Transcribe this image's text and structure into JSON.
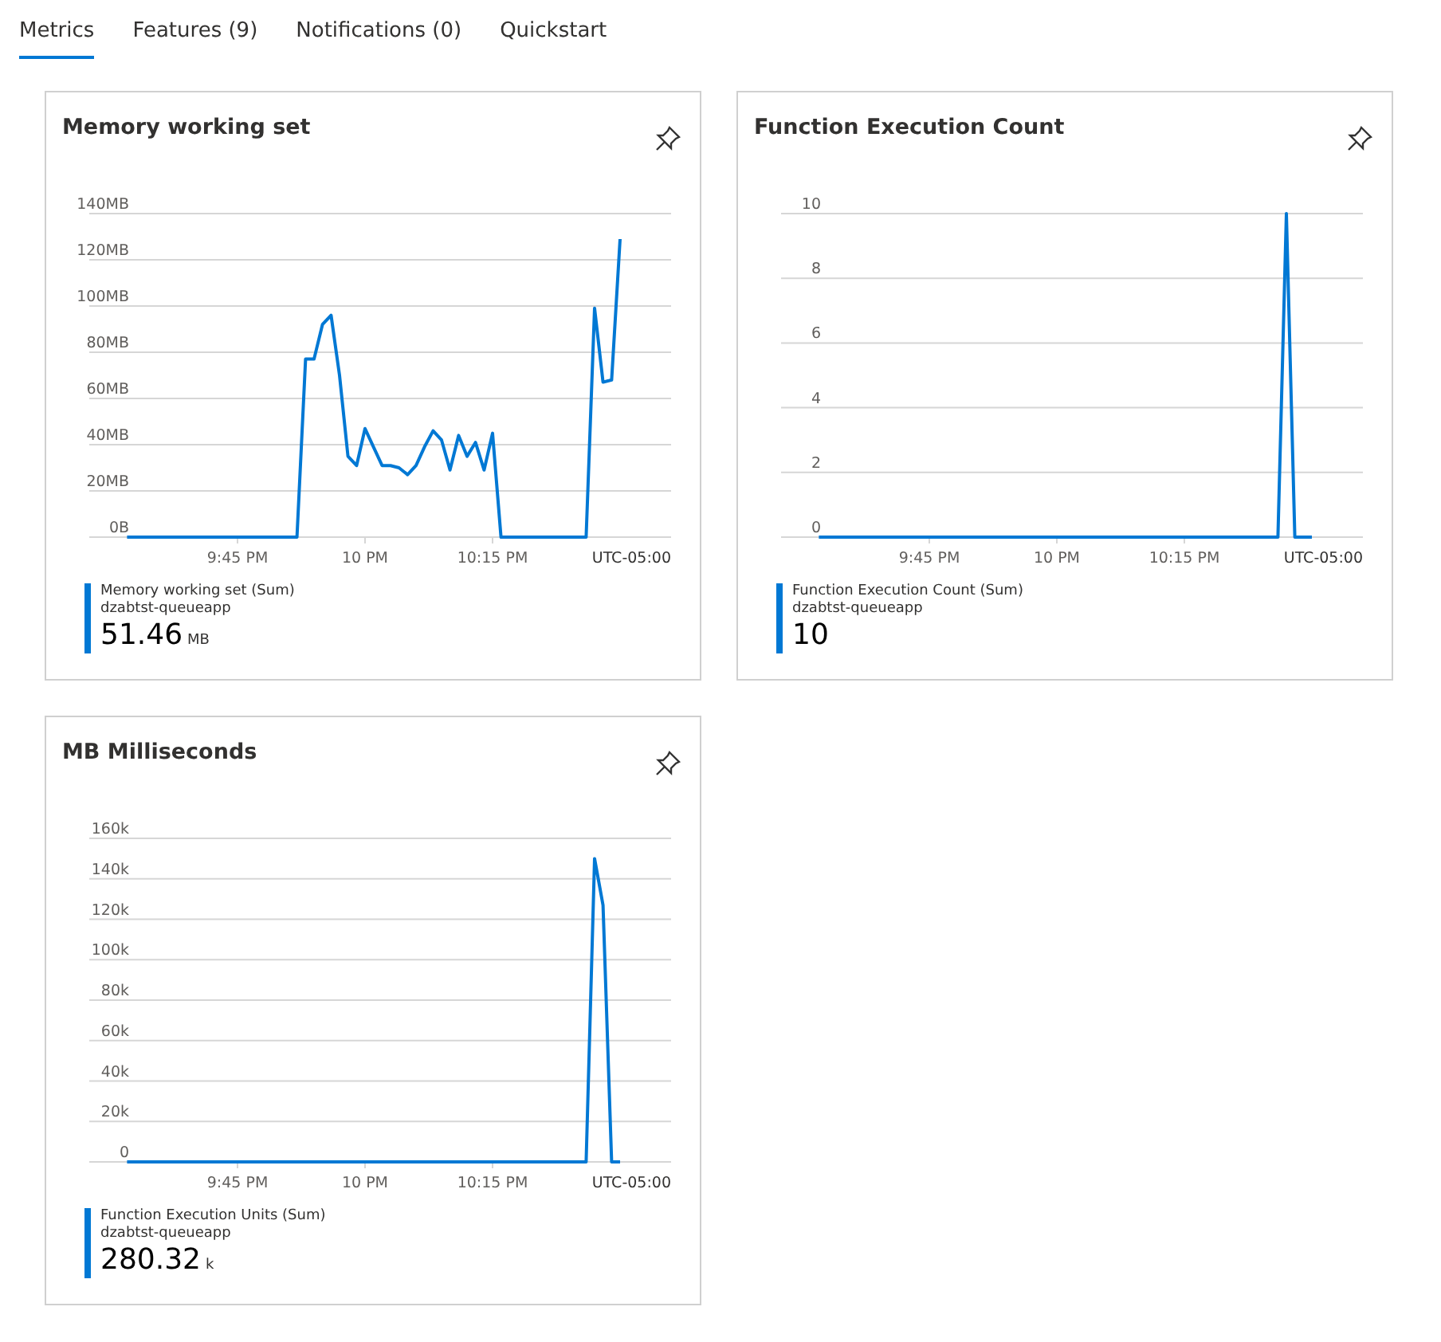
{
  "tabs": [
    {
      "label": "Metrics",
      "selected": true
    },
    {
      "label": "Features (9)",
      "selected": false
    },
    {
      "label": "Notifications (0)",
      "selected": false
    },
    {
      "label": "Quickstart",
      "selected": false
    }
  ],
  "cards": [
    {
      "title": "Memory working set",
      "chart_data": {
        "type": "line",
        "grid": true,
        "xlabel": "UTC-05:00",
        "ylim": [
          0,
          140
        ],
        "categories": [
          null,
          null,
          null,
          null,
          null,
          null,
          null,
          null,
          null,
          null,
          null,
          null,
          null,
          null,
          null,
          "9:45 PM",
          null,
          null,
          null,
          null,
          null,
          null,
          null,
          null,
          null,
          null,
          null,
          null,
          null,
          null,
          "10 PM",
          null,
          null,
          null,
          null,
          null,
          null,
          null,
          null,
          null,
          null,
          null,
          null,
          null,
          null,
          "10:15 PM",
          null,
          null,
          null,
          null,
          null,
          null,
          null,
          null,
          null,
          null,
          null,
          null,
          null,
          null,
          null,
          null,
          null,
          null,
          null,
          null
        ],
        "yticks": [
          {
            "value": 0,
            "label": "0B"
          },
          {
            "value": 20,
            "label": "20MB"
          },
          {
            "value": 40,
            "label": "40MB"
          },
          {
            "value": 60,
            "label": "60MB"
          },
          {
            "value": 80,
            "label": "80MB"
          },
          {
            "value": 100,
            "label": "100MB"
          },
          {
            "value": 120,
            "label": "120MB"
          },
          {
            "value": 140,
            "label": "140MB"
          }
        ],
        "series": [
          {
            "name": "Memory working set (Sum)",
            "color": "#0078d4",
            "values": [
              null,
              null,
              0,
              0,
              0,
              0,
              0,
              0,
              0,
              0,
              0,
              0,
              0,
              0,
              0,
              0,
              0,
              0,
              0,
              0,
              0,
              0,
              0,
              77,
              77,
              92,
              96,
              70,
              35,
              31,
              47,
              39,
              31,
              31,
              30,
              27,
              31,
              39,
              46,
              42,
              29,
              44,
              35,
              41,
              29,
              45,
              0,
              0,
              0,
              0,
              0,
              0,
              0,
              0,
              0,
              0,
              0,
              99,
              67,
              68,
              129,
              null,
              null,
              null,
              null,
              null
            ]
          }
        ]
      },
      "legend": {
        "resource": "dzabtst-queueapp",
        "value": "51.46",
        "unit": "MB"
      }
    },
    {
      "title": "Function Execution Count",
      "chart_data": {
        "type": "line",
        "grid": true,
        "xlabel": "UTC-05:00",
        "ylim": [
          0,
          10
        ],
        "categories": [
          null,
          null,
          null,
          null,
          null,
          null,
          null,
          null,
          null,
          null,
          null,
          null,
          null,
          null,
          null,
          "9:45 PM",
          null,
          null,
          null,
          null,
          null,
          null,
          null,
          null,
          null,
          null,
          null,
          null,
          null,
          null,
          "10 PM",
          null,
          null,
          null,
          null,
          null,
          null,
          null,
          null,
          null,
          null,
          null,
          null,
          null,
          null,
          "10:15 PM",
          null,
          null,
          null,
          null,
          null,
          null,
          null,
          null,
          null,
          null,
          null,
          null,
          null,
          null,
          null,
          null,
          null,
          null,
          null,
          null
        ],
        "yticks": [
          0,
          2,
          4,
          6,
          8,
          10
        ],
        "series": [
          {
            "name": "Function Execution Count (Sum)",
            "color": "#0078d4",
            "values": [
              null,
              null,
              0,
              0,
              0,
              0,
              0,
              0,
              0,
              0,
              0,
              0,
              0,
              0,
              0,
              0,
              0,
              0,
              0,
              0,
              0,
              0,
              0,
              0,
              0,
              0,
              0,
              0,
              0,
              0,
              0,
              0,
              0,
              0,
              0,
              0,
              0,
              0,
              0,
              0,
              0,
              0,
              0,
              0,
              0,
              0,
              0,
              0,
              0,
              0,
              0,
              0,
              0,
              0,
              0,
              0,
              0,
              10,
              0,
              0,
              0,
              null,
              null,
              null,
              null,
              null
            ]
          }
        ]
      },
      "legend": {
        "resource": "dzabtst-queueapp",
        "value": "10"
      }
    },
    {
      "title": "MB Milliseconds",
      "chart_data": {
        "type": "line",
        "grid": true,
        "xlabel": "UTC-05:00",
        "ylim": [
          0,
          160
        ],
        "categories": [
          null,
          null,
          null,
          null,
          null,
          null,
          null,
          null,
          null,
          null,
          null,
          null,
          null,
          null,
          null,
          "9:45 PM",
          null,
          null,
          null,
          null,
          null,
          null,
          null,
          null,
          null,
          null,
          null,
          null,
          null,
          null,
          "10 PM",
          null,
          null,
          null,
          null,
          null,
          null,
          null,
          null,
          null,
          null,
          null,
          null,
          null,
          null,
          "10:15 PM",
          null,
          null,
          null,
          null,
          null,
          null,
          null,
          null,
          null,
          null,
          null,
          null,
          null,
          null,
          null,
          null,
          null,
          null,
          null,
          null
        ],
        "yticks": [
          {
            "value": 0,
            "label": "0"
          },
          {
            "value": 20,
            "label": "20k"
          },
          {
            "value": 40,
            "label": "40k"
          },
          {
            "value": 60,
            "label": "60k"
          },
          {
            "value": 80,
            "label": "80k"
          },
          {
            "value": 100,
            "label": "100k"
          },
          {
            "value": 120,
            "label": "120k"
          },
          {
            "value": 140,
            "label": "140k"
          },
          {
            "value": 160,
            "label": "160k"
          }
        ],
        "series": [
          {
            "name": "Function Execution Units (Sum)",
            "color": "#0078d4",
            "values": [
              null,
              null,
              0,
              0,
              0,
              0,
              0,
              0,
              0,
              0,
              0,
              0,
              0,
              0,
              0,
              0,
              0,
              0,
              0,
              0,
              0,
              0,
              0,
              0,
              0,
              0,
              0,
              0,
              0,
              0,
              0,
              0,
              0,
              0,
              0,
              0,
              0,
              0,
              0,
              0,
              0,
              0,
              0,
              0,
              0,
              0,
              0,
              0,
              0,
              0,
              0,
              0,
              0,
              0,
              0,
              0,
              0,
              150,
              127,
              0,
              0,
              null,
              null,
              null,
              null,
              null
            ]
          }
        ]
      },
      "legend": {
        "resource": "dzabtst-queueapp",
        "value": "280.32",
        "unit": "k"
      }
    }
  ]
}
